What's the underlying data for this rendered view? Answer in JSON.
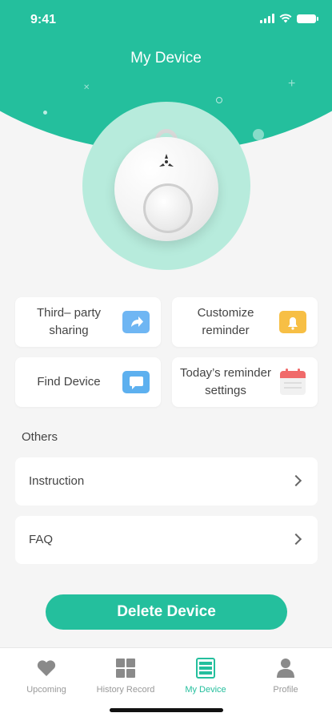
{
  "status_bar": {
    "time": "9:41",
    "icons": [
      "signal-icon",
      "wifi-icon",
      "battery-icon"
    ]
  },
  "header": {
    "title": "My Device"
  },
  "colors": {
    "accent": "#24bf9d",
    "device_circle": "#b7ebdc",
    "inactive_tab": "#999999"
  },
  "quick_actions": [
    {
      "label": "Third– party sharing",
      "icon": "share-icon"
    },
    {
      "label": "Customize reminder",
      "icon": "bell-icon"
    },
    {
      "label": "Find Device",
      "icon": "find-device-icon"
    },
    {
      "label": "Today’s reminder settings",
      "icon": "calendar-icon"
    }
  ],
  "others": {
    "title": "Others",
    "items": [
      {
        "label": "Instruction",
        "icon": "chevron-right-icon"
      },
      {
        "label": "FAQ",
        "icon": "chevron-right-icon"
      }
    ]
  },
  "delete_button": {
    "label": "Delete Device"
  },
  "tab_bar": {
    "active_tab": "My Device",
    "tabs": [
      {
        "label": "Upcoming",
        "icon": "heart-icon"
      },
      {
        "label": "History Record",
        "icon": "grid-icon"
      },
      {
        "label": "My Device",
        "icon": "device-icon"
      },
      {
        "label": "Profile",
        "icon": "person-icon"
      }
    ]
  }
}
